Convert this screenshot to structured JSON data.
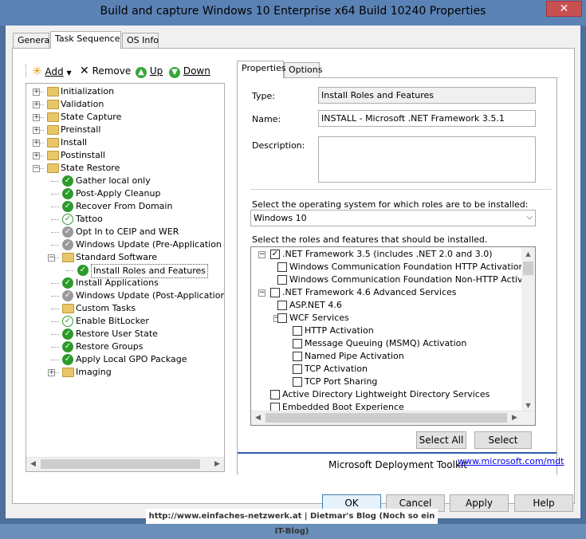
{
  "window": {
    "title": "Build and capture Windows 10 Enterprise x64 Build 10240 Properties",
    "close_label": "✕"
  },
  "tabs": [
    {
      "label": "General"
    },
    {
      "label": "Task Sequence"
    },
    {
      "label": "OS Info"
    }
  ],
  "toolbar": {
    "add_label": "Add",
    "remove_label": "Remove",
    "up_label": "Up",
    "down_label": "Down"
  },
  "tree": {
    "items": [
      {
        "label": "Initialization",
        "kind": "folder",
        "level": 0,
        "expander": "+"
      },
      {
        "label": "Validation",
        "kind": "folder",
        "level": 0,
        "expander": "+"
      },
      {
        "label": "State Capture",
        "kind": "folder",
        "level": 0,
        "expander": "+"
      },
      {
        "label": "Preinstall",
        "kind": "folder",
        "level": 0,
        "expander": "+"
      },
      {
        "label": "Install",
        "kind": "folder",
        "level": 0,
        "expander": "+"
      },
      {
        "label": "Postinstall",
        "kind": "folder",
        "level": 0,
        "expander": "+"
      },
      {
        "label": "State Restore",
        "kind": "folder",
        "level": 0,
        "expander": "−"
      },
      {
        "label": "Gather local only",
        "kind": "check",
        "level": 1
      },
      {
        "label": "Post-Apply Cleanup",
        "kind": "check",
        "level": 1
      },
      {
        "label": "Recover From Domain",
        "kind": "check",
        "level": 1
      },
      {
        "label": "Tattoo",
        "kind": "check-light",
        "level": 1
      },
      {
        "label": "Opt In to CEIP and WER",
        "kind": "grey",
        "level": 1
      },
      {
        "label": "Windows Update (Pre-Application Installa",
        "kind": "grey",
        "level": 1
      },
      {
        "label": "Standard Software",
        "kind": "folder",
        "level": 1,
        "expander": "−"
      },
      {
        "label": "Install Roles and Features",
        "kind": "check",
        "level": 2,
        "selected": true
      },
      {
        "label": "Install Applications",
        "kind": "check",
        "level": 1
      },
      {
        "label": "Windows Update (Post-Application Installa",
        "kind": "grey",
        "level": 1
      },
      {
        "label": "Custom Tasks",
        "kind": "folder",
        "level": 1
      },
      {
        "label": "Enable BitLocker",
        "kind": "check-light",
        "level": 1
      },
      {
        "label": "Restore User State",
        "kind": "check",
        "level": 1
      },
      {
        "label": "Restore Groups",
        "kind": "check",
        "level": 1
      },
      {
        "label": "Apply Local GPO Package",
        "kind": "check",
        "level": 1
      },
      {
        "label": "Imaging",
        "kind": "folder",
        "level": 1,
        "expander": "+"
      }
    ]
  },
  "subtabs": [
    {
      "label": "Properties"
    },
    {
      "label": "Options"
    }
  ],
  "properties": {
    "type_label": "Type:",
    "type_value": "Install Roles and Features",
    "name_label": "Name:",
    "name_value": "INSTALL - Microsoft .NET Framework 3.5.1",
    "description_label": "Description:",
    "description_value": "",
    "os_label": "Select the operating system for which roles are to be installed:",
    "os_value": "Windows 10",
    "roles_label": "Select the roles and features that should be installed."
  },
  "roles": [
    {
      "label": ".NET Framework 3.5 (includes .NET 2.0 and 3.0)",
      "level": 0,
      "checked": true,
      "expander": "−"
    },
    {
      "label": "Windows Communication Foundation HTTP Activation",
      "level": 1,
      "checked": false
    },
    {
      "label": "Windows Communication Foundation Non-HTTP Activation",
      "level": 1,
      "checked": false
    },
    {
      "label": ".NET Framework 4.6 Advanced Services",
      "level": 0,
      "checked": false,
      "expander": "−"
    },
    {
      "label": "ASP.NET 4.6",
      "level": 1,
      "checked": false
    },
    {
      "label": "WCF Services",
      "level": 1,
      "checked": false,
      "expander": "−"
    },
    {
      "label": "HTTP Activation",
      "level": 2,
      "checked": false
    },
    {
      "label": "Message Queuing (MSMQ) Activation",
      "level": 2,
      "checked": false
    },
    {
      "label": "Named Pipe Activation",
      "level": 2,
      "checked": false
    },
    {
      "label": "TCP Activation",
      "level": 2,
      "checked": false
    },
    {
      "label": "TCP Port Sharing",
      "level": 2,
      "checked": false
    },
    {
      "label": "Active Directory Lightweight Directory Services",
      "level": 0,
      "checked": false
    },
    {
      "label": "Embedded Boot Experience",
      "level": 0,
      "checked": false
    }
  ],
  "buttons": {
    "select_all": "Select All",
    "select_none": "Select None",
    "ok": "OK",
    "cancel": "Cancel",
    "apply": "Apply",
    "help": "Help"
  },
  "footer": {
    "brand": "Microsoft Deployment Toolkit",
    "link": "www.microsoft.com/mdt"
  },
  "watermark": "http://www.einfaches-netzwerk.at | Dietmar's Blog (Noch so ein IT-Blog)"
}
